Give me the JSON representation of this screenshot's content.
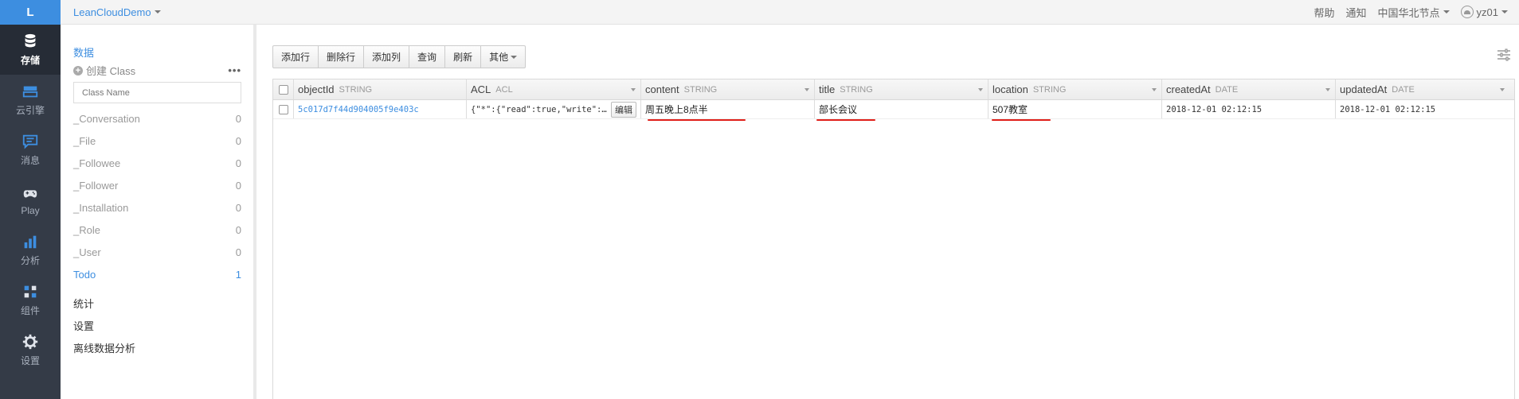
{
  "logo": "L",
  "nav": [
    {
      "label": "存储",
      "icon": "database-icon",
      "active": true
    },
    {
      "label": "云引擎",
      "icon": "server-icon"
    },
    {
      "label": "消息",
      "icon": "message-icon"
    },
    {
      "label": "Play",
      "icon": "gamepad-icon"
    },
    {
      "label": "分析",
      "icon": "bar-chart-icon"
    },
    {
      "label": "组件",
      "icon": "components-icon"
    },
    {
      "label": "设置",
      "icon": "gear-icon"
    }
  ],
  "header": {
    "app_name": "LeanCloudDemo",
    "help": "帮助",
    "notify": "通知",
    "region": "中国华北节点",
    "user": "yz01"
  },
  "sidebar": {
    "section": "数据",
    "create_label": "创建 Class",
    "more": "•••",
    "search_placeholder": "Class Name",
    "classes": [
      {
        "name": "_Conversation",
        "count": "0"
      },
      {
        "name": "_File",
        "count": "0"
      },
      {
        "name": "_Followee",
        "count": "0"
      },
      {
        "name": "_Follower",
        "count": "0"
      },
      {
        "name": "_Installation",
        "count": "0"
      },
      {
        "name": "_Role",
        "count": "0"
      },
      {
        "name": "_User",
        "count": "0"
      },
      {
        "name": "Todo",
        "count": "1"
      }
    ],
    "links": [
      "统计",
      "设置",
      "离线数据分析"
    ]
  },
  "toolbar": {
    "add_row": "添加行",
    "delete_row": "删除行",
    "add_col": "添加列",
    "query": "查询",
    "refresh": "刷新",
    "other": "其他"
  },
  "table": {
    "columns": [
      {
        "name": "objectId",
        "type": "STRING"
      },
      {
        "name": "ACL",
        "type": "ACL"
      },
      {
        "name": "content",
        "type": "STRING"
      },
      {
        "name": "title",
        "type": "STRING"
      },
      {
        "name": "location",
        "type": "STRING"
      },
      {
        "name": "createdAt",
        "type": "DATE"
      },
      {
        "name": "updatedAt",
        "type": "DATE"
      }
    ],
    "rows": [
      {
        "objectId": "5c017d7f44d904005f9e403c",
        "acl": "{\"*\":{\"read\":true,\"write\":true}}",
        "edit": "编辑",
        "content": "周五晚上8点半",
        "title": "部长会议",
        "location": "507教室",
        "createdAt": "2018-12-01 02:12:15",
        "updatedAt": "2018-12-01 02:12:15"
      }
    ]
  },
  "colors": {
    "accent": "#3d8ee0",
    "sidebar_bg": "#343b47",
    "annotation": "#e0201a"
  }
}
